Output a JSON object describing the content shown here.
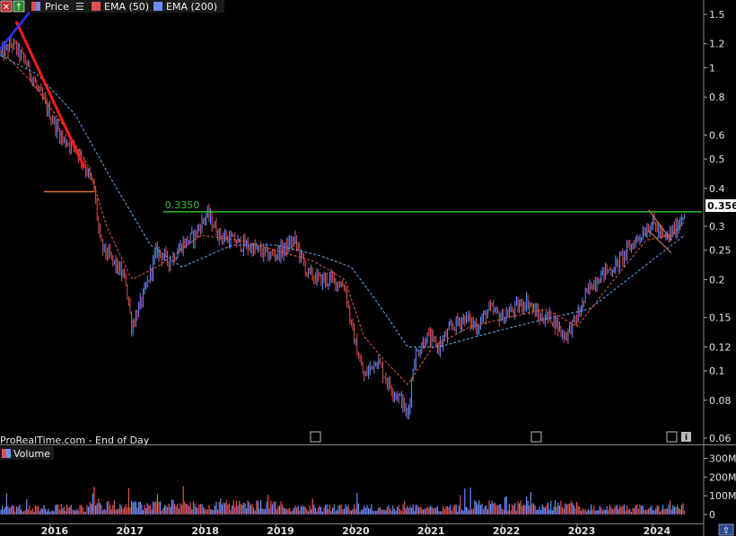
{
  "toolbar": {
    "price_label": "Price",
    "ema50_label": "EMA (50)",
    "ema200_label": "EMA (200)",
    "volume_label": "Volume"
  },
  "watermark": "ProRealTime.com - End of Day",
  "colors": {
    "background": "#000000",
    "up": "#6b8cff",
    "down": "#e05050",
    "ema50": "#d05a3a",
    "ema200": "#5aa0e0",
    "resistance_line": "#30c030",
    "trend_line_red": "#ff1a1a",
    "trend_line_blue": "#3030ff",
    "support_line": "#e07030",
    "price_badge_bg": "#ffffff",
    "price_badge_text": "#000000"
  },
  "chart_data": {
    "type": "line",
    "price_scale": "log",
    "ylim": [
      0.06,
      1.6
    ],
    "y_ticks": [
      1.5,
      1.2,
      1,
      0.8,
      0.6,
      0.5,
      0.4,
      0.3,
      0.25,
      0.2,
      0.15,
      0.12,
      0.1,
      0.08,
      0.06
    ],
    "x_range": [
      "2015-05",
      "2024-08"
    ],
    "x_ticks": [
      "2016",
      "2017",
      "2018",
      "2019",
      "2020",
      "2021",
      "2022",
      "2023",
      "2024"
    ],
    "last_price": "0.3560",
    "resistance": {
      "label": "0.3350",
      "value": 0.335,
      "from": "2017-07",
      "to": "2024-08"
    },
    "support_2016": {
      "value": 0.39,
      "from": "2015-12",
      "to": "2016-08"
    },
    "series": [
      {
        "name": "Price",
        "x": [
          "2015-05",
          "2015-07",
          "2015-09",
          "2015-11",
          "2016-01",
          "2016-03",
          "2016-05",
          "2016-06",
          "2016-07",
          "2016-08",
          "2016-09",
          "2016-11",
          "2017-01",
          "2017-02",
          "2017-04",
          "2017-06",
          "2017-08",
          "2017-10",
          "2017-12",
          "2018-02",
          "2018-04",
          "2018-06",
          "2018-08",
          "2018-10",
          "2018-12",
          "2019-02",
          "2019-04",
          "2019-06",
          "2019-08",
          "2019-10",
          "2019-12",
          "2020-01",
          "2020-03",
          "2020-05",
          "2020-07",
          "2020-09",
          "2020-10",
          "2020-11",
          "2021-01",
          "2021-03",
          "2021-05",
          "2021-07",
          "2021-09",
          "2021-11",
          "2022-01",
          "2022-03",
          "2022-05",
          "2022-07",
          "2022-09",
          "2022-11",
          "2023-01",
          "2023-03",
          "2023-05",
          "2023-07",
          "2023-09",
          "2023-11",
          "2024-01",
          "2024-03",
          "2024-05",
          "2024-07",
          "2024-08"
        ],
        "y": [
          1.1,
          1.2,
          1.05,
          0.85,
          0.7,
          0.58,
          0.55,
          0.5,
          0.45,
          0.4,
          0.26,
          0.23,
          0.2,
          0.14,
          0.18,
          0.25,
          0.23,
          0.26,
          0.28,
          0.33,
          0.28,
          0.27,
          0.26,
          0.25,
          0.24,
          0.25,
          0.27,
          0.21,
          0.2,
          0.2,
          0.19,
          0.14,
          0.095,
          0.11,
          0.09,
          0.08,
          0.07,
          0.11,
          0.13,
          0.12,
          0.14,
          0.15,
          0.14,
          0.16,
          0.15,
          0.16,
          0.17,
          0.15,
          0.15,
          0.13,
          0.15,
          0.19,
          0.21,
          0.22,
          0.25,
          0.28,
          0.31,
          0.27,
          0.3,
          0.37,
          0.356
        ]
      },
      {
        "name": "EMA (50)",
        "x": [
          "2015-05",
          "2015-10",
          "2016-03",
          "2016-07",
          "2016-10",
          "2017-02",
          "2017-06",
          "2018-01",
          "2018-07",
          "2019-01",
          "2019-07",
          "2019-12",
          "2020-03",
          "2020-06",
          "2020-10",
          "2021-02",
          "2021-08",
          "2022-02",
          "2022-08",
          "2023-01",
          "2023-06",
          "2023-12",
          "2024-04",
          "2024-08"
        ],
        "y": [
          1.15,
          0.9,
          0.65,
          0.48,
          0.3,
          0.2,
          0.22,
          0.28,
          0.27,
          0.25,
          0.23,
          0.2,
          0.13,
          0.11,
          0.09,
          0.12,
          0.14,
          0.15,
          0.16,
          0.14,
          0.19,
          0.27,
          0.28,
          0.34
        ]
      },
      {
        "name": "EMA (200)",
        "x": [
          "2015-05",
          "2015-11",
          "2016-05",
          "2016-11",
          "2017-05",
          "2017-10",
          "2018-06",
          "2019-01",
          "2019-08",
          "2020-01",
          "2020-05",
          "2020-10",
          "2021-03",
          "2021-09",
          "2022-03",
          "2022-09",
          "2023-03",
          "2023-09",
          "2024-03",
          "2024-08"
        ],
        "y": [
          1.1,
          0.95,
          0.7,
          0.42,
          0.26,
          0.22,
          0.26,
          0.26,
          0.24,
          0.22,
          0.17,
          0.12,
          0.12,
          0.13,
          0.14,
          0.15,
          0.16,
          0.2,
          0.25,
          0.3
        ]
      }
    ],
    "volume": {
      "y_ticks": [
        "300M",
        "200M",
        "100M",
        "0"
      ],
      "ylim": [
        0,
        360
      ]
    }
  }
}
